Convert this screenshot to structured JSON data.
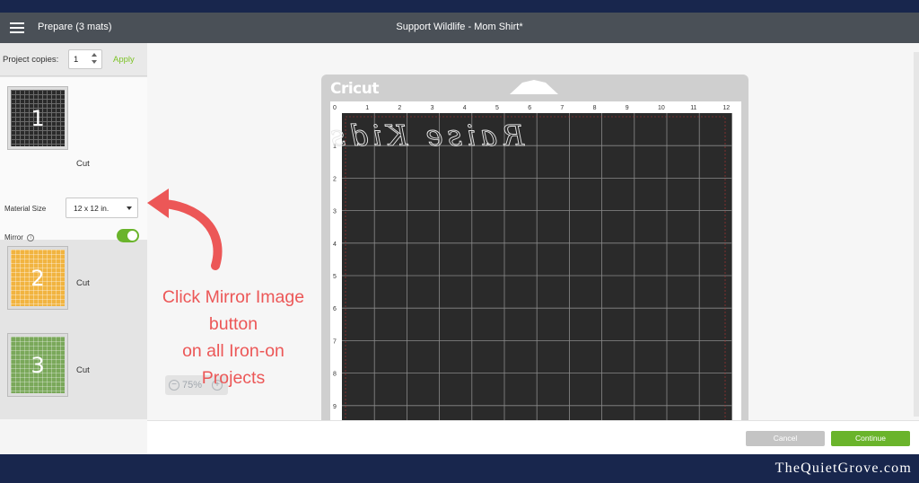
{
  "topbar": {
    "prepare_label": "Prepare (3 mats)",
    "doc_title": "Support Wildlife - Mom Shirt*"
  },
  "sidebar": {
    "project_copies_label": "Project copies:",
    "project_copies_value": "1",
    "apply_label": "Apply",
    "mats": [
      {
        "number": "1",
        "label": "Cut",
        "color": "#2a2a2a"
      },
      {
        "number": "2",
        "label": "Cut",
        "color": "#f1b440"
      },
      {
        "number": "3",
        "label": "Cut",
        "color": "#7aa85a"
      }
    ],
    "material_size_label": "Material Size",
    "material_size_value": "12 x 12 in.",
    "mirror_label": "Mirror",
    "mirror_on": true
  },
  "canvas": {
    "logo": "Cricut",
    "zoom": "75%",
    "ruler_top": [
      "0",
      "1",
      "2",
      "3",
      "4",
      "5",
      "6",
      "7",
      "8",
      "9",
      "10",
      "11",
      "12"
    ],
    "ruler_left": [
      "1",
      "2",
      "3",
      "4",
      "5",
      "6",
      "7",
      "8",
      "9"
    ],
    "design_text": "Raise Kids",
    "mat_color": "#2a2a2a"
  },
  "footer": {
    "cancel_label": "Cancel",
    "continue_label": "Continue"
  },
  "annotation": {
    "lines": [
      "Click Mirror Image",
      "button",
      "on all Iron-on",
      "Projects"
    ],
    "color": "#ec5757"
  },
  "watermark": "TheQuietGrove.com",
  "colors": {
    "accent_green": "#6ab42b",
    "topbar": "#4a5057",
    "page_border": "#18264d"
  }
}
